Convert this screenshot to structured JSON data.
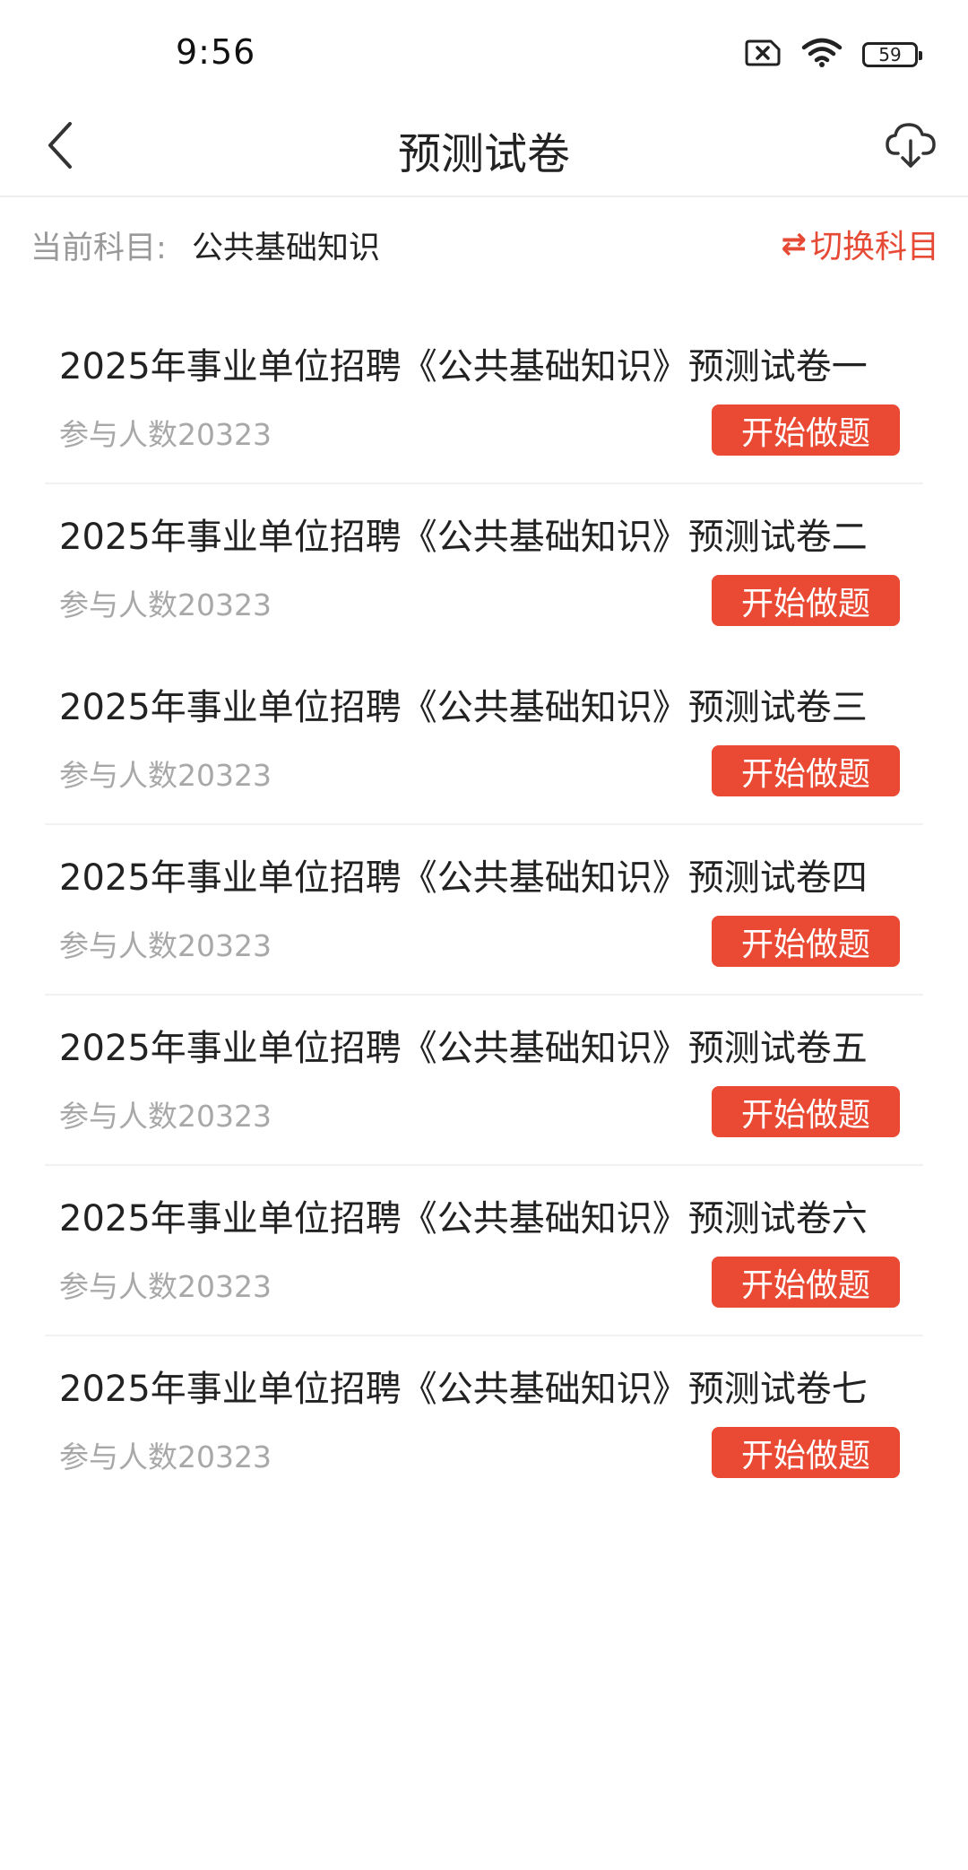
{
  "status_bar": {
    "time": "9:56",
    "battery": "59",
    "icons": [
      "sim-x-icon",
      "wifi-icon",
      "battery-icon"
    ]
  },
  "nav": {
    "title": "预测试卷",
    "back_icon": "chevron-left-icon",
    "download_icon": "cloud-download-icon"
  },
  "subject": {
    "label": "当前科目:",
    "value": "公共基础知识",
    "switch_icon": "⇄",
    "switch_label": "切换科目"
  },
  "papers": [
    {
      "title": "2025年事业单位招聘《公共基础知识》预测试卷一",
      "count": "参与人数20323",
      "button": "开始做题"
    },
    {
      "title": "2025年事业单位招聘《公共基础知识》预测试卷二",
      "count": "参与人数20323",
      "button": "开始做题"
    },
    {
      "title": "2025年事业单位招聘《公共基础知识》预测试卷三",
      "count": "参与人数20323",
      "button": "开始做题"
    },
    {
      "title": "2025年事业单位招聘《公共基础知识》预测试卷四",
      "count": "参与人数20323",
      "button": "开始做题"
    },
    {
      "title": "2025年事业单位招聘《公共基础知识》预测试卷五",
      "count": "参与人数20323",
      "button": "开始做题"
    },
    {
      "title": "2025年事业单位招聘《公共基础知识》预测试卷六",
      "count": "参与人数20323",
      "button": "开始做题"
    },
    {
      "title": "2025年事业单位招聘《公共基础知识》预测试卷七",
      "count": "参与人数20323",
      "button": "开始做题"
    }
  ],
  "colors": {
    "accent": "#ea4a34",
    "muted_text": "#a8a8a8",
    "primary_text": "#222222"
  }
}
